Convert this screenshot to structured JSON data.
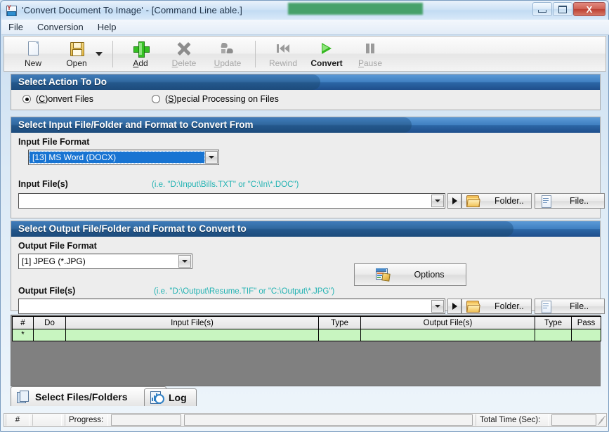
{
  "window": {
    "title": "'Convert Document To Image' - [Command Line able.]",
    "icon": "document-convert-icon",
    "redaction_color": "#3f9e63",
    "controls": {
      "minimize": "minimize-icon",
      "maximize": "maximize-icon",
      "close": "X"
    }
  },
  "menubar": {
    "items": [
      {
        "label": "File"
      },
      {
        "label": "Conversion"
      },
      {
        "label": "Help"
      }
    ]
  },
  "toolbar": {
    "buttons": [
      {
        "label": "New",
        "icon": "new-page-icon",
        "enabled": true,
        "accel": ""
      },
      {
        "label": "Open",
        "icon": "open-save-icon",
        "enabled": true,
        "accel": ""
      },
      {
        "label": "Add",
        "icon": "plus-icon",
        "enabled": true,
        "accel": "A"
      },
      {
        "label": "Delete",
        "icon": "x-mark-icon",
        "enabled": false,
        "accel": "D"
      },
      {
        "label": "Update",
        "icon": "refresh-icon",
        "enabled": false,
        "accel": "U"
      },
      {
        "label": "Rewind",
        "icon": "rewind-icon",
        "enabled": false,
        "accel": ""
      },
      {
        "label": "Convert",
        "icon": "play-icon",
        "enabled": true,
        "accel": ""
      },
      {
        "label": "Pause",
        "icon": "pause-icon",
        "enabled": false,
        "accel": "P"
      }
    ],
    "dropdown_caret": "chevron-down-icon"
  },
  "sections": {
    "action": {
      "banner": "Select Action To Do",
      "options": [
        {
          "label_prefix": "(",
          "accel": "C",
          "label_suffix": ")onvert Files",
          "selected": true
        },
        {
          "label_prefix": "(",
          "accel": "S",
          "label_suffix": ")pecial Processing on Files",
          "selected": false
        }
      ]
    },
    "input": {
      "banner": "Select Input File/Folder and Format to Convert From",
      "format_label": "Input File Format",
      "format_value": "[13] MS Word (DOCX)",
      "files_label": "Input File(s)",
      "files_hint": "(i.e. \"D:\\Input\\Bills.TXT\"  or \"C:\\In\\*.DOC\")",
      "files_value": "",
      "folder_button": "Folder..",
      "file_button": "File.."
    },
    "output": {
      "banner": "Select Output File/Folder and Format to Convert to",
      "format_label": "Output File Format",
      "format_value": "[1] JPEG (*.JPG)",
      "options_button": "Options",
      "files_label": "Output File(s)",
      "files_hint": "(i.e. \"D:\\Output\\Resume.TIF\" or \"C:\\Output\\*.JPG\")",
      "files_value": "",
      "folder_button": "Folder..",
      "file_button": "File.."
    }
  },
  "grid": {
    "columns": [
      "#",
      "Do",
      "Input File(s)",
      "Type",
      "Output File(s)",
      "Type",
      "Pass"
    ],
    "rows": [
      {
        "num": "*",
        "do": "",
        "input": "",
        "intype": "",
        "output": "",
        "outtype": "",
        "pass": ""
      }
    ],
    "row_color": "#c8f5c0"
  },
  "tabs": [
    {
      "label": "Select Files/Folders",
      "icon": "pages-icon",
      "active": true
    },
    {
      "label": "Log",
      "icon": "log-clock-icon",
      "active": false
    }
  ],
  "statusbar": {
    "num_label": "#",
    "num_value": "",
    "progress_label": "Progress:",
    "progress_value": "",
    "message": "",
    "total_time_label": "Total Time (Sec):",
    "total_time_value": ""
  }
}
